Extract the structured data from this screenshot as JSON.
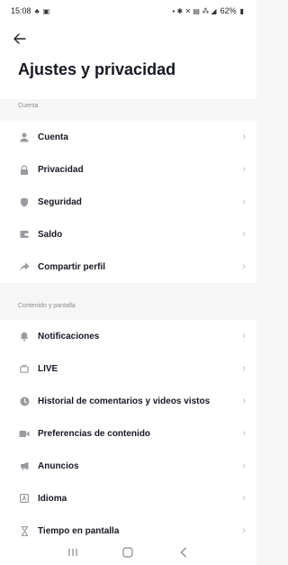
{
  "status": {
    "time": "15:08",
    "battery": "62%"
  },
  "header": {
    "title": "Ajustes y privacidad"
  },
  "sections": [
    {
      "label": "Cuenta",
      "items": [
        {
          "label": "Cuenta",
          "icon": "person-icon"
        },
        {
          "label": "Privacidad",
          "icon": "lock-icon"
        },
        {
          "label": "Seguridad",
          "icon": "shield-icon"
        },
        {
          "label": "Saldo",
          "icon": "wallet-icon"
        },
        {
          "label": "Compartir perfil",
          "icon": "share-icon"
        }
      ]
    },
    {
      "label": "Contenido y pantalla",
      "items": [
        {
          "label": "Notificaciones",
          "icon": "bell-icon"
        },
        {
          "label": "LIVE",
          "icon": "tv-icon"
        },
        {
          "label": "Historial de comentarios y videos vistos",
          "icon": "history-icon"
        },
        {
          "label": "Preferencias de contenido",
          "icon": "video-icon"
        },
        {
          "label": "Anuncios",
          "icon": "megaphone-icon"
        },
        {
          "label": "Idioma",
          "icon": "language-icon"
        },
        {
          "label": "Tiempo en pantalla",
          "icon": "hourglass-icon"
        }
      ]
    }
  ],
  "colors": {
    "icon": "#9a9ba0",
    "chevron": "#b8b9bd",
    "background": "#f6f6f6"
  }
}
